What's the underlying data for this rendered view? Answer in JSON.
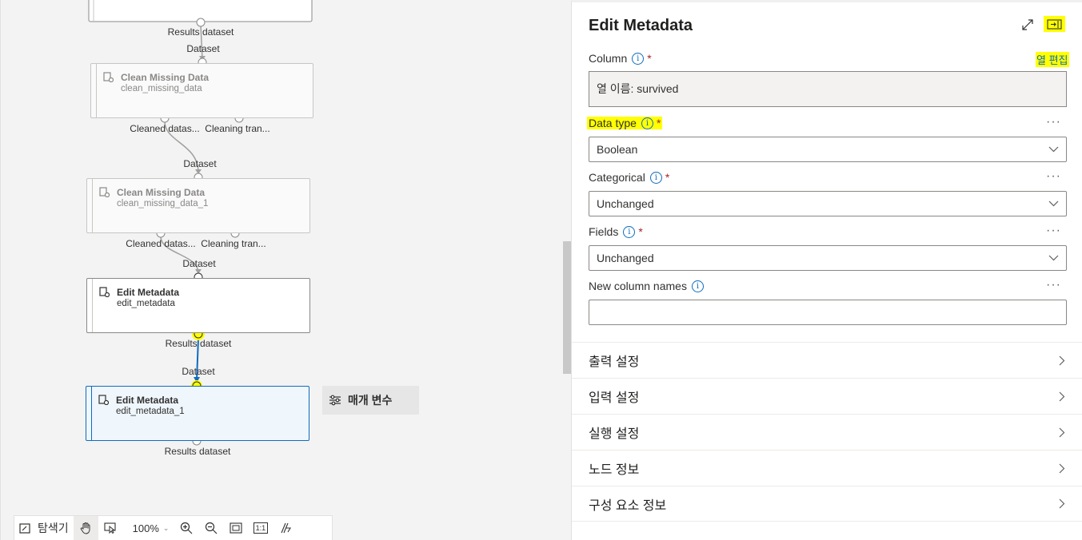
{
  "canvas": {
    "nodes": [
      {
        "title": "Clean Missing Data",
        "sub": "clean_missing_data"
      },
      {
        "title": "Clean Missing Data",
        "sub": "clean_missing_data_1"
      },
      {
        "title": "Edit Metadata",
        "sub": "edit_metadata"
      },
      {
        "title": "Edit Metadata",
        "sub": "edit_metadata_1"
      }
    ],
    "ports": {
      "results_dataset": "Results dataset",
      "dataset": "Dataset",
      "cleaned_dataset": "Cleaned datas...",
      "cleaning_transform": "Cleaning tran..."
    },
    "parameters_button": "매개 변수",
    "toolbar": {
      "explorer": "탐색기",
      "zoom": "100%",
      "actual_size": "1:1"
    }
  },
  "panel": {
    "title": "Edit Metadata",
    "column": {
      "label": "Column",
      "required": "*",
      "edit_link": "열 편집",
      "value": "열 이름: survived"
    },
    "data_type": {
      "label": "Data type",
      "required": "*",
      "value": "Boolean"
    },
    "categorical": {
      "label": "Categorical",
      "required": "*",
      "value": "Unchanged"
    },
    "fields": {
      "label": "Fields",
      "required": "*",
      "value": "Unchanged"
    },
    "new_column_names": {
      "label": "New column names",
      "value": ""
    },
    "more": "···",
    "info": "i",
    "sections": [
      {
        "label": "출력 설정"
      },
      {
        "label": "입력 설정"
      },
      {
        "label": "실행 설정"
      },
      {
        "label": "노드 정보"
      },
      {
        "label": "구성 요소 정보"
      }
    ]
  },
  "colors": {
    "highlight": "#ffff00",
    "accent": "#0f6cbd",
    "wire_active": "#0f6cbd",
    "wire": "#a19f9d"
  }
}
